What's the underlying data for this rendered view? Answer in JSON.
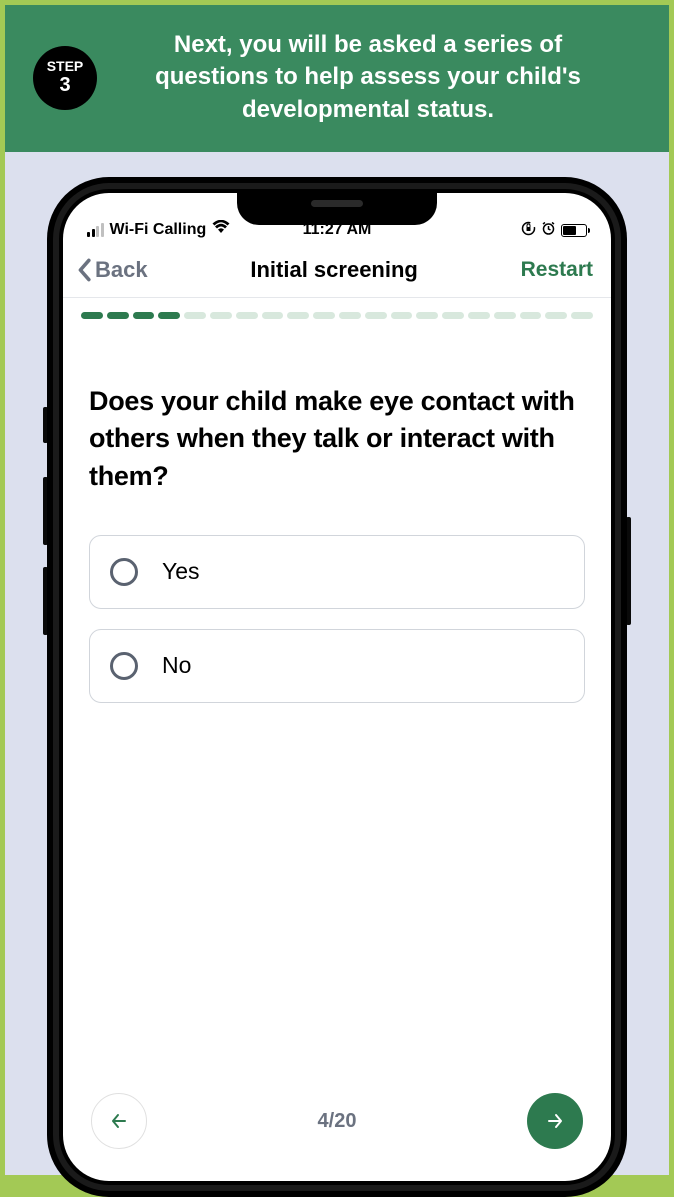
{
  "banner": {
    "step_label": "STEP",
    "step_number": "3",
    "description": "Next, you will be asked a series of questions to help assess your child's developmental status."
  },
  "status_bar": {
    "carrier": "Wi-Fi Calling",
    "time": "11:27 AM"
  },
  "nav": {
    "back_label": "Back",
    "title": "Initial screening",
    "restart_label": "Restart"
  },
  "progress": {
    "current": 4,
    "total": 20
  },
  "question": {
    "text": "Does your child make eye contact with others when they talk or interact with them?"
  },
  "options": [
    {
      "label": "Yes"
    },
    {
      "label": "No"
    }
  ],
  "footer": {
    "counter": "4/20"
  },
  "colors": {
    "accent": "#2d7a4f",
    "banner_bg": "#3a8a5f",
    "outer_border": "#a3c955"
  }
}
